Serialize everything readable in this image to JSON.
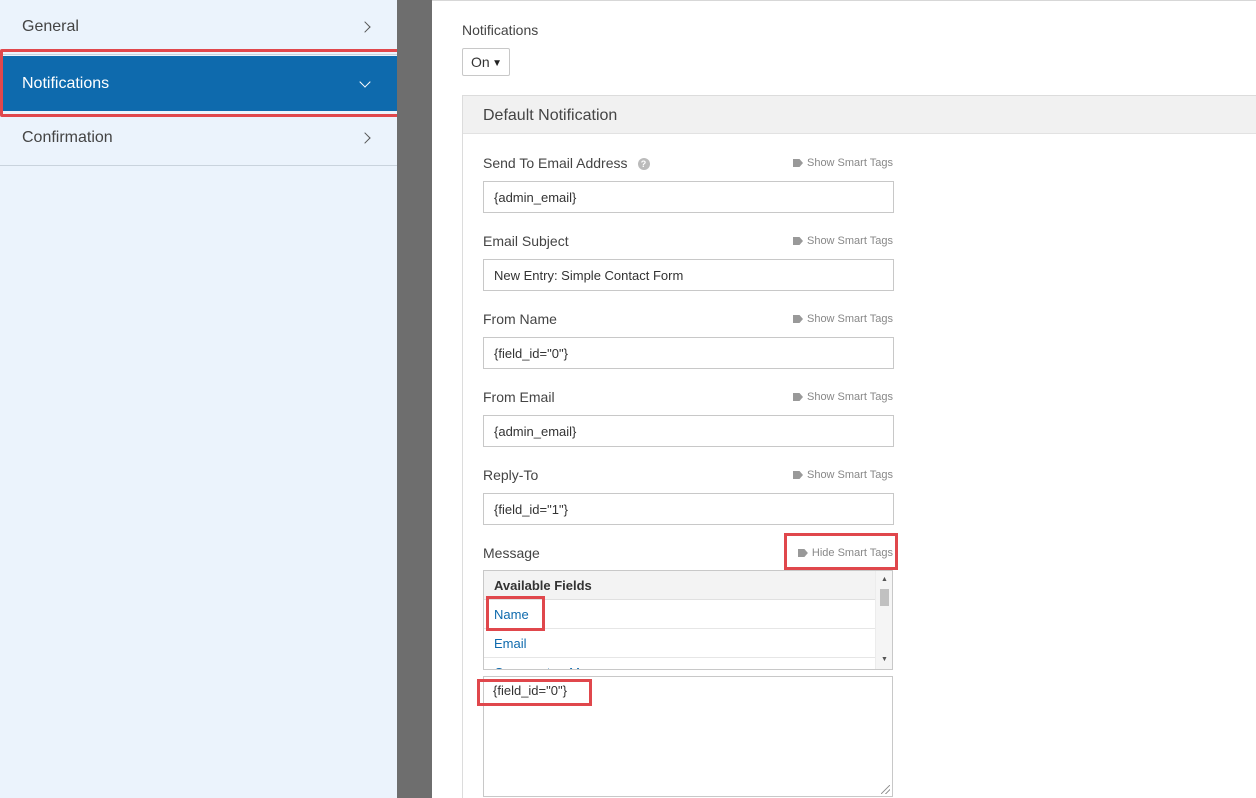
{
  "sidebar": {
    "items": [
      {
        "label": "General"
      },
      {
        "label": "Notifications"
      },
      {
        "label": "Confirmation"
      }
    ]
  },
  "notifications": {
    "label": "Notifications",
    "select_value": "On"
  },
  "panel": {
    "title": "Default Notification",
    "show_tags_label": "Show Smart Tags",
    "hide_tags_label": "Hide Smart Tags",
    "fields": {
      "send_to": {
        "label": "Send To Email Address",
        "value": "{admin_email}"
      },
      "subject": {
        "label": "Email Subject",
        "value": "New Entry: Simple Contact Form"
      },
      "from_name": {
        "label": "From Name",
        "value": "{field_id=\"0\"}"
      },
      "from_email": {
        "label": "From Email",
        "value": "{admin_email}"
      },
      "reply_to": {
        "label": "Reply-To",
        "value": "{field_id=\"1\"}"
      },
      "message": {
        "label": "Message",
        "value": "{field_id=\"0\"}"
      }
    },
    "available_fields": {
      "heading": "Available Fields",
      "items": [
        "Name",
        "Email",
        "Comment or Message"
      ]
    }
  },
  "icons": {
    "help": "question-circle-icon",
    "tag": "tag-icon"
  },
  "colors": {
    "accent": "#0e6aad",
    "highlight": "#e0474c",
    "sidebar_bg": "#ebf3fc"
  }
}
